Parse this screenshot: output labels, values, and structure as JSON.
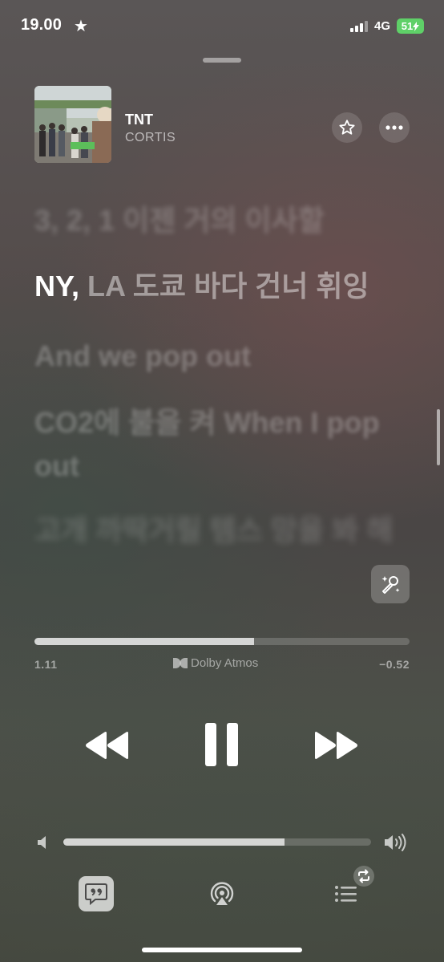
{
  "status_bar": {
    "time": "19.00",
    "star": "★",
    "network": "4G",
    "battery": "51",
    "battery_color": "#5fd068"
  },
  "track": {
    "title": "TNT",
    "artist": "CORTIS",
    "album_art_text": "GREENGREEN"
  },
  "lyrics": {
    "previous_line": "3, 2, 1 이젠 거의 이사할",
    "current_line_sung": "NY,",
    "current_line_unsung": "LA 도쿄 바다 건너 휘잉",
    "next_lines": [
      "And we pop out",
      "CO2에 불을 켜 When I pop out",
      "고개 까딱거릴 템스 망을 봐 해"
    ]
  },
  "progress": {
    "elapsed": "1.11",
    "remaining": "−0.52",
    "fraction": 0.585,
    "audio_format": "Dolby Atmos"
  },
  "volume": {
    "fraction": 0.72
  },
  "icons": {
    "favorite": "star-outline-icon",
    "more": "ellipsis-icon",
    "sing": "microphone-sparkle-icon",
    "rewind": "rewind-icon",
    "pause": "pause-icon",
    "forward": "fast-forward-icon",
    "lyrics": "quote-bubble-icon",
    "airplay": "airplay-audio-icon",
    "queue": "queue-list-icon"
  }
}
